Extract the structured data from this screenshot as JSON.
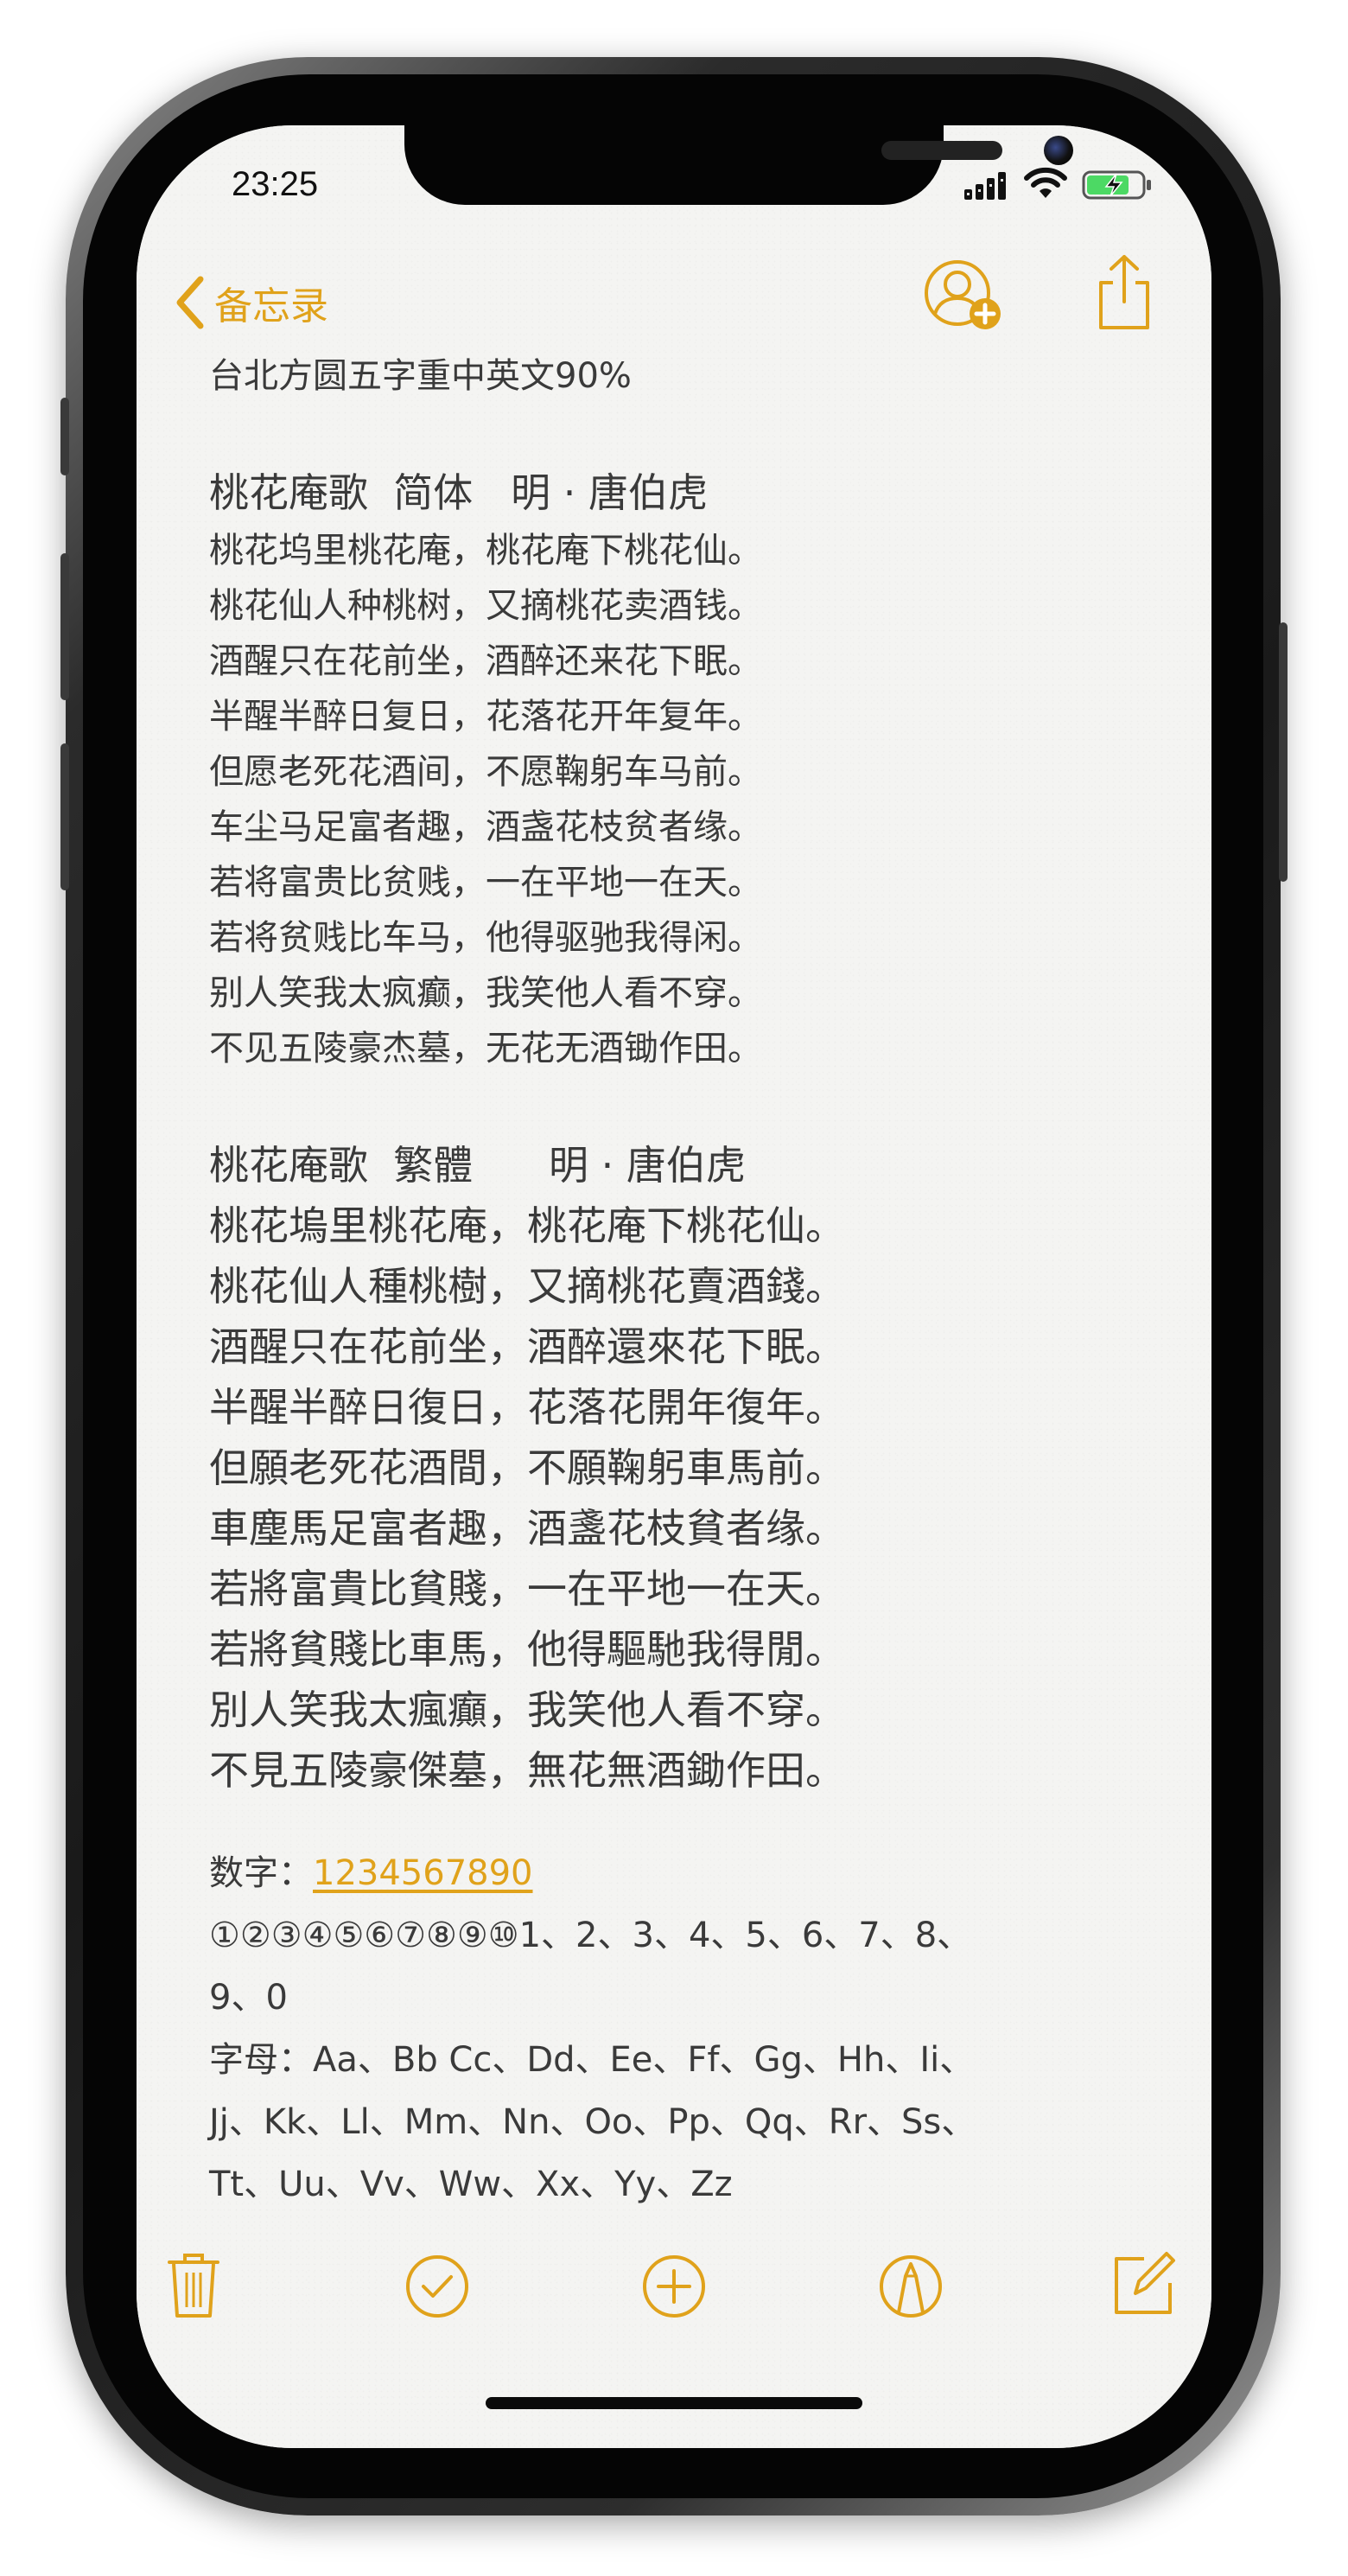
{
  "status_bar": {
    "time": "23:25"
  },
  "nav": {
    "back_label": "备忘录"
  },
  "note": {
    "lines_a": [
      "台北方圆五字重中英文90%"
    ],
    "section_simplified": {
      "heading": "桃花庵歌  简体   明 · 唐伯虎",
      "lines": [
        "桃花坞里桃花庵，桃花庵下桃花仙。",
        "桃花仙人种桃树，又摘桃花卖酒钱。",
        "酒醒只在花前坐，酒醉还来花下眠。",
        "半醒半醉日复日，花落花开年复年。",
        "但愿老死花酒间，不愿鞠躬车马前。",
        "车尘马足富者趣，酒盏花枝贫者缘。",
        "若将富贵比贫贱，一在平地一在天。",
        "若将贫贱比车马，他得驱驰我得闲。",
        "别人笑我太疯癫，我笑他人看不穿。",
        "不见五陵豪杰墓，无花无酒锄作田。"
      ]
    },
    "section_traditional": {
      "heading": "桃花庵歌  繁體      明 · 唐伯虎",
      "lines": [
        "桃花塢里桃花庵，桃花庵下桃花仙。",
        "桃花仙人種桃樹，又摘桃花賣酒錢。",
        "酒醒只在花前坐，酒醉還來花下眠。",
        "半醒半醉日復日，花落花開年復年。",
        "但願老死花酒間，不願鞠躬車馬前。",
        "車塵馬足富者趣，酒盞花枝貧者缘。",
        "若將富貴比貧賤，一在平地一在天。",
        "若將貧賤比車馬，他得驅馳我得閒。",
        "別人笑我太瘋癲，我笑他人看不穿。",
        "不見五陵豪傑墓，無花無酒鋤作田。"
      ]
    },
    "numbers_label": "数字：",
    "numbers_link": "1234567890",
    "numbers_line": "①②③④⑤⑥⑦⑧⑨⑩1、2、3、4、5、6、7、8、",
    "numbers_line_2": "9、0",
    "letters_line_1": "字母：Aa、Bb Cc、Dd、Ee、Ff、Gg、Hh、Ii、",
    "letters_line_2": "Jj、Kk、Ll、Mm、Nn、Oo、Pp、Qq、Rr、Ss、",
    "letters_line_3": "Tt、Uu、Vv、Ww、Xx、Yy、Zz"
  },
  "colors": {
    "accent": "#e0a21b",
    "text": "#3a3a3a",
    "paper": "#f4f4f2"
  },
  "icons": {
    "nav": [
      "chevron-left-icon",
      "add-person-icon",
      "share-icon"
    ],
    "toolbar": [
      "trash-icon",
      "checklist-icon",
      "add-icon",
      "markup-icon",
      "compose-icon"
    ]
  }
}
